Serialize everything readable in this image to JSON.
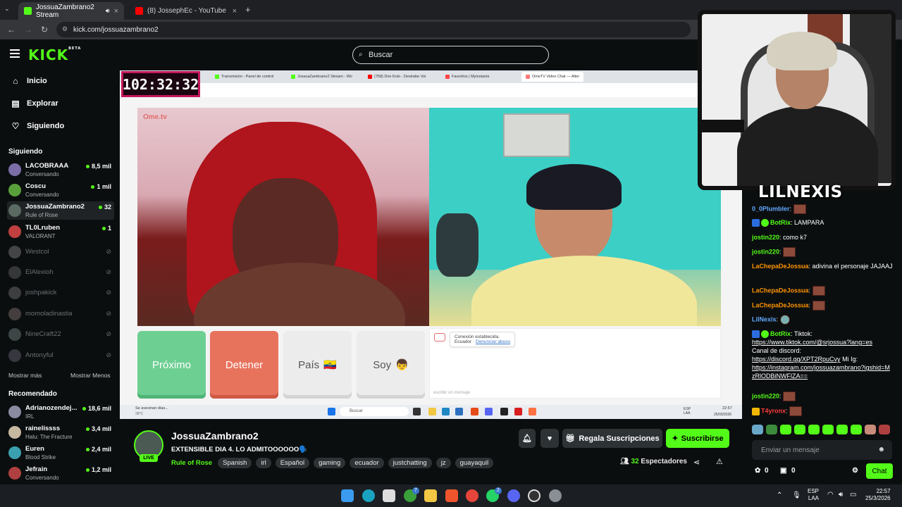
{
  "browser": {
    "tabs": [
      {
        "label": "JossuaZambrano2 Stream",
        "active": true,
        "favicon_color": "#53fc18"
      },
      {
        "label": "(8) JossephEc - YouTube",
        "active": false,
        "favicon_color": "#ff0000"
      }
    ],
    "new_tab": "+",
    "url": "kick.com/jossuazambrano2"
  },
  "header": {
    "logo": "KICK",
    "logo_badge": "BETA",
    "search_placeholder": "Buscar"
  },
  "sidebar": {
    "nav": [
      {
        "label": "Inicio",
        "icon": "home-icon",
        "glyph": "⌂"
      },
      {
        "label": "Explorar",
        "icon": "explore-icon",
        "glyph": "▤"
      },
      {
        "label": "Siguiendo",
        "icon": "heart-icon",
        "glyph": "♡"
      }
    ],
    "following_title": "Siguiendo",
    "following": [
      {
        "name": "LACOBRAAA",
        "sub": "Conversando",
        "viewers": "8,5 mil",
        "live": true,
        "color": "#7b6ea8"
      },
      {
        "name": "Coscu",
        "sub": "Conversando",
        "viewers": "1 mil",
        "live": true,
        "color": "#5aa03a"
      },
      {
        "name": "JossuaZambrano2",
        "sub": "Rule of Rose",
        "viewers": "32",
        "live": true,
        "color": "#5b6a63"
      },
      {
        "name": "TL0Lruben",
        "sub": "VALORANT",
        "viewers": "1",
        "live": true,
        "color": "#c04040"
      },
      {
        "name": "Westcol",
        "live": false,
        "color": "#8a8a8a"
      },
      {
        "name": "ElAlexioh",
        "live": false,
        "color": "#6a6a6a"
      },
      {
        "name": "joshpakick",
        "live": false,
        "color": "#7a7a7a"
      },
      {
        "name": "momoladinastia",
        "live": false,
        "color": "#8a7a7a"
      },
      {
        "name": "NineCraft22",
        "live": false,
        "color": "#7a8a8a"
      },
      {
        "name": "Antonyful",
        "live": false,
        "color": "#6a6a7a"
      }
    ],
    "show_more": "Mostrar más",
    "show_less": "Mostrar Menos",
    "recommended_title": "Recomendado",
    "recommended": [
      {
        "name": "Adrianozendej...",
        "sub": "IRL",
        "viewers": "18,6 mil",
        "color": "#8a8aa0"
      },
      {
        "name": "rainelissss",
        "sub": "Halu: The Fracture",
        "viewers": "3,4 mil",
        "color": "#c7b8a0"
      },
      {
        "name": "Euren",
        "sub": "Blood Strike",
        "viewers": "2,4 mil",
        "color": "#3aa0b0"
      },
      {
        "name": "Jefrain",
        "sub": "Conversando",
        "viewers": "1,2 mil",
        "color": "#b04040"
      }
    ]
  },
  "stream_view": {
    "timer": "102:32:32",
    "inner_tabs": [
      {
        "label": "Transmisión - Panel de control",
        "color": "#53fc18"
      },
      {
        "label": "JossuaZambrano2 Stream - Wo",
        "color": "#53fc18"
      },
      {
        "label": "(758) Don Kolo - Destrabe Voi",
        "color": "#ff0000"
      },
      {
        "label": "Favoritos | Myinstants",
        "color": "#ff4444"
      },
      {
        "label": "OmeTV Video Chat — Alter",
        "color": "#ff7b7b"
      }
    ],
    "ometv_logo": "Ome.tv",
    "buttons": {
      "next": "Próximo",
      "stop": "Detener",
      "country": "País",
      "country_flag": "🇪🇨",
      "gender": "Soy",
      "gender_emoji": "👦"
    },
    "connection": {
      "status": "Conexión establecida.",
      "country": "Ecuador",
      "report": "Denunciar abuso"
    },
    "message_placeholder": "escribir un mensaje",
    "inner_taskbar": {
      "weather": "Se avecinan días...",
      "weather_temp": "28°C",
      "search": "Buscar",
      "lang": "ESP\nLAA",
      "time": "22:57",
      "date": "25/03/2026"
    }
  },
  "overlay": {
    "streamer_name": "LILNEXIS"
  },
  "chat": {
    "messages": [
      {
        "user": "0_0Plumbler",
        "color": "blue",
        "text": "",
        "emote": true
      },
      {
        "user": "BotRix",
        "color": "green",
        "text": "LAMPARA",
        "badges": true
      },
      {
        "user": "jostin220",
        "color": "green",
        "text": "como k7"
      },
      {
        "user": "jostin220",
        "color": "green",
        "text": "",
        "emote": true
      },
      {
        "user": "LaChepaDeJossua",
        "color": "orange",
        "text": "adivina el personaje JAJAAJ"
      },
      {
        "user": "LaChepaDeJossua",
        "color": "orange",
        "text": "",
        "emote": true
      },
      {
        "user": "LaChepaDeJossua",
        "color": "orange",
        "text": "",
        "emote": true
      },
      {
        "user": "LilNexis",
        "color": "blue",
        "text": "",
        "emote": true
      },
      {
        "user": "BotRix",
        "color": "green",
        "text": "Tiktok:",
        "badges": true
      },
      {
        "user": "jostin220",
        "color": "green",
        "text": "",
        "emote": true
      },
      {
        "user": "T4yronx",
        "color": "red",
        "text": "",
        "emote": true
      }
    ],
    "botrix_links": {
      "tiktok": "https://www.tiktok.com/@srjossua?lang=es",
      "discord_label": "Canal de discord:",
      "discord": "https://discord.gg/XPT2RpuCvy",
      "ig_label": "Mi Ig:",
      "instagram": "https://instagram.com/jossuazambrano?igshid=MzRlODBiNWFlZA=="
    },
    "input_placeholder": "Enviar un mensaje",
    "kicks": "0",
    "points": "0",
    "send_label": "Chat"
  },
  "stream_info": {
    "channel": "JossuaZambrano2",
    "live_badge": "LIVE",
    "title": "EXTENSIBLE DIA 4. LO ADMITOOOOOO🗣️",
    "category": "Rule of Rose",
    "tags": [
      "Spanish",
      "irl",
      "Español",
      "gaming",
      "ecuador",
      "justchatting",
      "jz",
      "guayaquil"
    ],
    "gift_label": "Regala Suscripciones",
    "subscribe_label": "Suscribirse",
    "viewer_count": "32",
    "viewer_label": "Espectadores"
  },
  "taskbar": {
    "lang_top": "ESP",
    "lang_bottom": "LAA",
    "time": "22:57",
    "date": "25/3/2026",
    "badges": {
      "xbox": "7",
      "whatsapp": "2"
    }
  },
  "colors": {
    "kick_green": "#53fc18",
    "bg": "#0b0e0f",
    "panel": "#2d3235"
  }
}
